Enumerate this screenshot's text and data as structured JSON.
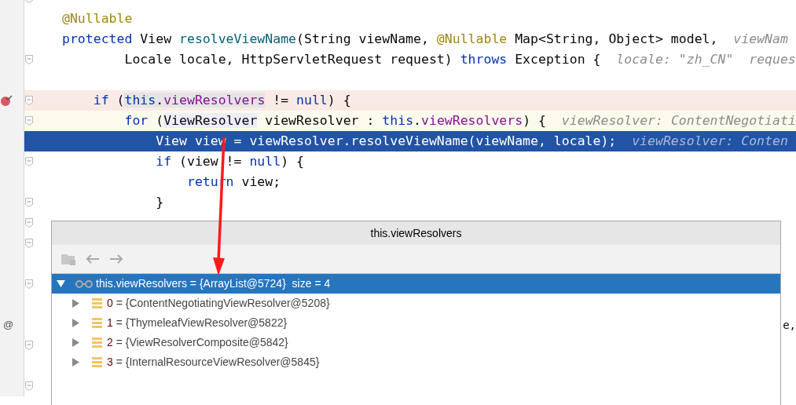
{
  "editor": {
    "lines": [
      {
        "kind": "fold_marker"
      },
      {
        "kind": "code",
        "breakpoint": false,
        "caret_line": false,
        "execution_point": false,
        "fold": false,
        "tokens": [
          {
            "kind": "annotation",
            "text": "@Nullable"
          }
        ]
      },
      {
        "kind": "code",
        "breakpoint": false,
        "caret_line": false,
        "execution_point": false,
        "fold": false,
        "tokens": [
          {
            "kind": "keyword",
            "text": "protected"
          },
          {
            "kind": "plain",
            "text": " View "
          },
          {
            "kind": "method",
            "text": "resolveViewName"
          },
          {
            "kind": "plain",
            "text": "(String viewName, "
          },
          {
            "kind": "annotation",
            "text": "@Nullable"
          },
          {
            "kind": "plain",
            "text": " Map<String, Object> model,  "
          },
          {
            "kind": "hint",
            "text": "viewNam"
          }
        ]
      },
      {
        "kind": "code",
        "breakpoint": false,
        "caret_line": false,
        "execution_point": false,
        "fold": true,
        "tokens": [
          {
            "kind": "plain",
            "text": "        Locale locale, HttpServletRequest request) "
          },
          {
            "kind": "keyword",
            "text": "throws"
          },
          {
            "kind": "plain",
            "text": " Exception {  "
          },
          {
            "kind": "hint",
            "text": "locale: \"zh_CN\"  reques"
          }
        ]
      },
      {
        "kind": "blank"
      },
      {
        "kind": "code",
        "breakpoint": true,
        "caret_line": false,
        "execution_point": false,
        "fold": true,
        "tokens": [
          {
            "kind": "keyword",
            "text": "    if"
          },
          {
            "kind": "plain",
            "text": " ("
          },
          {
            "kind": "keyword",
            "text": "this",
            "highlighted": true
          },
          {
            "kind": "plain",
            "text": ".",
            "highlighted": true
          },
          {
            "kind": "field",
            "text": "viewResolvers",
            "highlighted": true
          },
          {
            "kind": "plain",
            "text": " != "
          },
          {
            "kind": "keyword",
            "text": "null"
          },
          {
            "kind": "plain",
            "text": ") {"
          }
        ]
      },
      {
        "kind": "code",
        "breakpoint": false,
        "caret_line": true,
        "execution_point": false,
        "fold": true,
        "tokens": [
          {
            "kind": "keyword",
            "text": "        for"
          },
          {
            "kind": "plain",
            "text": " ("
          },
          {
            "kind": "plain",
            "text": "ViewResolver",
            "highlighted": true
          },
          {
            "kind": "plain",
            "text": " viewResolver : "
          },
          {
            "kind": "keyword",
            "text": "this"
          },
          {
            "kind": "plain",
            "text": "."
          },
          {
            "kind": "field",
            "text": "viewResolvers"
          },
          {
            "kind": "plain",
            "text": ") {  "
          },
          {
            "kind": "hint",
            "text": "viewResolver: ContentNegotiati"
          }
        ]
      },
      {
        "kind": "code",
        "breakpoint": false,
        "caret_line": false,
        "execution_point": true,
        "fold": false,
        "tokens": [
          {
            "kind": "plain",
            "text": "            View view = viewResolver.resolveViewName(viewName, locale);  "
          },
          {
            "kind": "hint",
            "text": "viewResolver: Conten"
          }
        ]
      },
      {
        "kind": "code",
        "breakpoint": false,
        "caret_line": false,
        "execution_point": false,
        "fold": true,
        "tokens": [
          {
            "kind": "keyword",
            "text": "            if"
          },
          {
            "kind": "plain",
            "text": " (view != "
          },
          {
            "kind": "keyword",
            "text": "null"
          },
          {
            "kind": "plain",
            "text": ") {"
          }
        ]
      },
      {
        "kind": "code",
        "breakpoint": false,
        "caret_line": false,
        "execution_point": false,
        "fold": false,
        "tokens": [
          {
            "kind": "keyword",
            "text": "                return"
          },
          {
            "kind": "plain",
            "text": " view;"
          }
        ]
      },
      {
        "kind": "code",
        "breakpoint": false,
        "caret_line": false,
        "execution_point": false,
        "fold": true,
        "tokens": [
          {
            "kind": "plain",
            "text": "            }"
          }
        ]
      },
      {
        "kind": "fold_marker"
      },
      {
        "kind": "fold_marker"
      },
      {
        "kind": "blank"
      },
      {
        "kind": "fold_marker"
      },
      {
        "kind": "blank"
      },
      {
        "kind": "partial",
        "marker": "@",
        "tail": "e,"
      },
      {
        "kind": "fold_marker"
      },
      {
        "kind": "blank"
      },
      {
        "kind": "fold_marker"
      }
    ]
  },
  "popup": {
    "title": "this.viewResolvers",
    "root": {
      "expanded": true,
      "selected": true,
      "name": "this.viewResolvers",
      "value": "= {ArrayList@5724}",
      "extra": "size = 4",
      "children": [
        {
          "expanded": false,
          "selected": false,
          "name": "0",
          "value": "= {ContentNegotiatingViewResolver@5208}"
        },
        {
          "expanded": false,
          "selected": false,
          "name": "1",
          "value": "= {ThymeleafViewResolver@5822}"
        },
        {
          "expanded": false,
          "selected": false,
          "name": "2",
          "value": "= {ViewResolverComposite@5842}"
        },
        {
          "expanded": false,
          "selected": false,
          "name": "3",
          "value": "= {InternalResourceViewResolver@5845}"
        }
      ]
    }
  }
}
